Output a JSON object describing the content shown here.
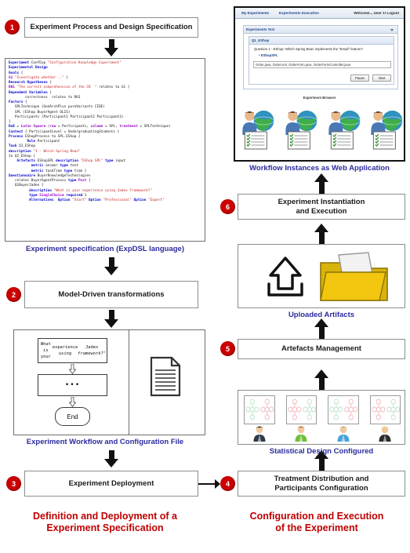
{
  "steps": {
    "s1": {
      "num": "1",
      "label": "Experiment Process and Design Specification"
    },
    "s2": {
      "num": "2",
      "label": "Model-Driven transformations"
    },
    "s3": {
      "num": "3",
      "label": "Experiment Deployment"
    },
    "s4": {
      "num": "4",
      "label": "Treatment Distribution and\nParticipants Configuration"
    },
    "s5": {
      "num": "5",
      "label": "Artefacts Management"
    },
    "s6": {
      "num": "6",
      "label": "Experiment Instantiation\nand Execution"
    }
  },
  "captions": {
    "spec": "Experiment specification (ExpDSL language)",
    "workflow": "Experiment Workflow and Configuration File",
    "webapp": "Workflow Instances as Web Application",
    "artifacts": "Uploaded Artifacts",
    "statistical": "Statistical Design Configured"
  },
  "headings": {
    "left": "Definition and Deployment of a\nExperiment Specification",
    "right": "Configuration and Execution\nof the Experiment",
    "accent_color": "#c00000"
  },
  "code": {
    "lines": [
      [
        [
          "kw",
          "Experiment"
        ],
        [
          "pl",
          " ConfExp "
        ],
        [
          "str",
          "\"Configuration Knowledge Experiment\""
        ]
      ],
      [
        [
          "kw",
          "Experimental Design"
        ]
      ],
      [
        [
          "kw",
          "Goals"
        ],
        [
          "pl",
          " {"
        ]
      ],
      [
        [
          "pp",
          "G1"
        ],
        [
          "pl",
          " "
        ],
        [
          "str",
          "\"Investigate whether ..\""
        ],
        [
          "pl",
          " }"
        ]
      ],
      [
        [
          "kw",
          "Research Hypotheses"
        ],
        [
          "pl",
          " {"
        ]
      ],
      [
        [
          "pp",
          "RH1"
        ],
        [
          "pl",
          " "
        ],
        [
          "str",
          "\"The correct comprehension of the CK  \""
        ],
        [
          "pl",
          " relates to G1 }"
        ]
      ],
      [
        [
          "kw",
          "Dependent Variables"
        ],
        [
          "pl",
          " {"
        ]
      ],
      [
        [
          "pl",
          "        correctness  relates to RH1"
        ]
      ],
      [
        [
          "kw",
          "Factors"
        ],
        [
          "pl",
          " {"
        ]
      ],
      [
        [
          "pl",
          "   SPLTechnique (GenArchPlus pureVariants CIDE)"
        ]
      ],
      [
        [
          "pl",
          "   SPL (EShop BuyerAgent OLIS)"
        ]
      ],
      [
        [
          "pl",
          "   Participants (Participant1 Participant2 Participant3)"
        ]
      ],
      [
        [
          "pl",
          "}"
        ]
      ],
      [
        [
          "kw",
          "DoE"
        ],
        [
          "pl",
          " = "
        ],
        [
          "pp",
          "Latin Square"
        ],
        [
          "pl",
          " ("
        ],
        [
          "pp",
          "row"
        ],
        [
          "pl",
          " = Participants, "
        ],
        [
          "pp",
          "column"
        ],
        [
          "pl",
          " = SPL, "
        ],
        [
          "pp",
          "treatment"
        ],
        [
          "pl",
          " = SPLTechnique)"
        ]
      ],
      [
        [
          "kw",
          "Context"
        ],
        [
          "pl",
          " { ParticipantLevel = UndergraduatingStudents }"
        ]
      ],
      [
        [
          "kw",
          "Process"
        ],
        [
          "pl",
          " EShopProcess to SPL.EShop {"
        ]
      ],
      [
        [
          "pl",
          "         "
        ],
        [
          "kw",
          "Role"
        ],
        [
          "pl",
          " Participant"
        ]
      ],
      [
        [
          "kw",
          "Task"
        ],
        [
          "pl",
          " Q1_EShop"
        ]
      ],
      [
        [
          "kw",
          "description"
        ],
        [
          "pl",
          " "
        ],
        [
          "str",
          "\"1 - Which Spring Bean\""
        ]
      ],
      [
        [
          "pl",
          "to Q2_EShop {"
        ]
      ],
      [
        [
          "pl",
          "    "
        ],
        [
          "kw",
          "Artefacts"
        ],
        [
          "pl",
          " EShopSPL "
        ],
        [
          "kw",
          "description"
        ],
        [
          "pl",
          " "
        ],
        [
          "str",
          "\"EShop SPL\""
        ],
        [
          "pl",
          " "
        ],
        [
          "kw",
          "type"
        ],
        [
          "pl",
          " input"
        ]
      ],
      [
        [
          "pl",
          "           "
        ],
        [
          "kw",
          "metric"
        ],
        [
          "pl",
          " answer "
        ],
        [
          "kw",
          "type"
        ],
        [
          "pl",
          " text"
        ]
      ],
      [
        [
          "pl",
          "           "
        ],
        [
          "kw",
          "metric"
        ],
        [
          "pl",
          " taskTime "
        ],
        [
          "kw",
          "type"
        ],
        [
          "pl",
          " time }"
        ]
      ],
      [
        [
          "pl",
          ""
        ]
      ],
      [
        [
          "pl",
          ""
        ]
      ],
      [
        [
          "kw",
          "Questionnaire"
        ],
        [
          "pl",
          " BuyerKnowledgeTechnologies"
        ]
      ],
      [
        [
          "pl",
          "   relates BuyerAgentProcess "
        ],
        [
          "kw",
          "type"
        ],
        [
          "pl",
          " "
        ],
        [
          "pp",
          "Post"
        ],
        [
          "pl",
          " {"
        ]
      ],
      [
        [
          "pl",
          "   Q1BuyerJadex {"
        ]
      ],
      [
        [
          "pl",
          "          "
        ],
        [
          "kw",
          "description"
        ],
        [
          "pl",
          " "
        ],
        [
          "str",
          "\"What is your experience using Jadex framework?\""
        ]
      ],
      [
        [
          "pl",
          "          "
        ],
        [
          "kw",
          "type"
        ],
        [
          "pl",
          " "
        ],
        [
          "pp",
          "SingleChoice"
        ],
        [
          "pl",
          " "
        ],
        [
          "kw",
          "required"
        ],
        [
          "pl",
          " 1"
        ]
      ],
      [
        [
          "pl",
          "          "
        ],
        [
          "kw",
          "Alternatives"
        ],
        [
          "pl",
          "  "
        ],
        [
          "kw",
          "Option"
        ],
        [
          "pl",
          " "
        ],
        [
          "str",
          "\"Start\""
        ],
        [
          "pl",
          " "
        ],
        [
          "kw",
          "Option"
        ],
        [
          "pl",
          " "
        ],
        [
          "str",
          "\"Professional\""
        ],
        [
          "pl",
          " "
        ],
        [
          "kw",
          "Option"
        ],
        [
          "pl",
          " "
        ],
        [
          "str",
          "\"Expert\""
        ]
      ]
    ]
  },
  "workflow": {
    "question_node": "What is your\nexperience using\nJadex framework?\"",
    "middle_node": "•••",
    "end_node": "End"
  },
  "webapp": {
    "nav": {
      "item1": "My Experiments",
      "item2": "Experiments Execution",
      "user": "Welcome.., User 1! Logout"
    },
    "panel_title": "Experiments Test",
    "section_title": "Q1_EShop",
    "question": "Question 1 - EShop: Which Spring Bean implements the \"Email\" feature?",
    "bullet": "EShopSPL",
    "answer_value": "Order.java, Order.xml, OrderForm.java, OrderFormController.java",
    "btn_pause": "Pause",
    "btn_next": "Next",
    "browser_label": "Experiment Browser",
    "participant_count": 4
  },
  "statistical": {
    "cell_count": 4
  }
}
